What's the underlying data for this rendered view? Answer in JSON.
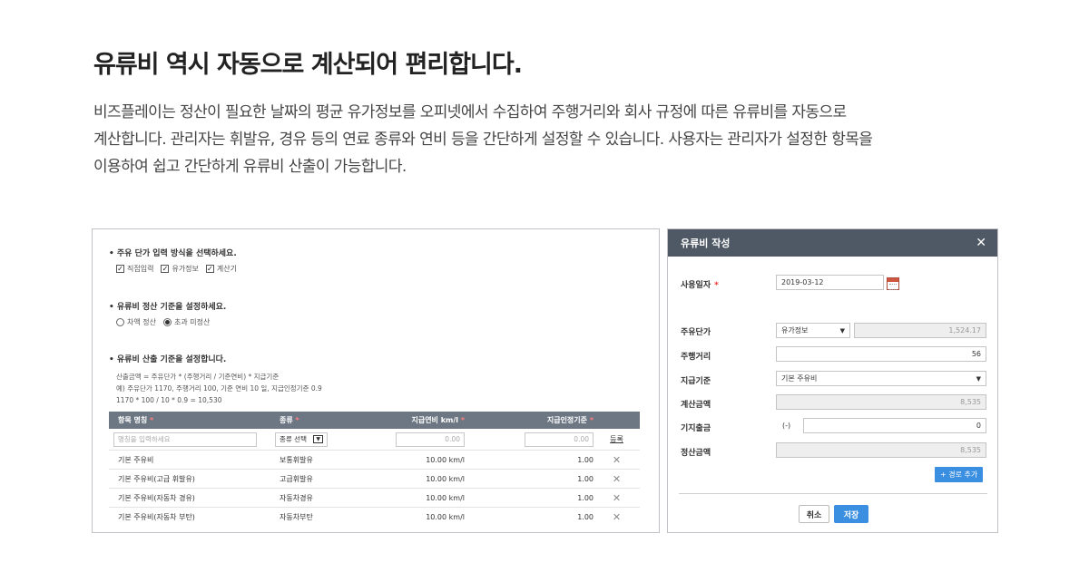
{
  "heading": "유류비 역시 자동으로 계산되어 편리합니다.",
  "description": [
    "비즈플레이는 정산이 필요한 날짜의 평균 유가정보를 오피넷에서 수집하여 주행거리와 회사 규정에 따른 유류비를 자동으로",
    "계산합니다. 관리자는 휘발유, 경유 등의 연료 종류와 연비 등을 간단하게 설정할 수 있습니다. 사용자는 관리자가 설정한 항목을",
    "이용하여 쉽고 간단하게 유류비 산출이 가능합니다."
  ],
  "settings": {
    "section1": {
      "title": "• 주유 단가 입력 방식을 선택하세요.",
      "options": [
        {
          "label": "직접입력",
          "checked": true
        },
        {
          "label": "유가정보",
          "checked": true
        },
        {
          "label": "계산기",
          "checked": true
        }
      ]
    },
    "section2": {
      "title": "• 유류비 정산 기준을 설정하세요.",
      "options": [
        {
          "label": "차액 정산",
          "selected": false
        },
        {
          "label": "초과 미정산",
          "selected": true
        }
      ]
    },
    "section3": {
      "title": "• 유류비 산출 기준을 설정합니다.",
      "formula": [
        "산출금액 = 주유단가 * (주행거리 / 기준연비) * 지급기준",
        "예) 주유단가 1170, 주행거리 100, 기준 연비 10 일, 지급인정기준 0.9",
        "      1170 * 100 / 10 * 0.9 = 10,530"
      ]
    },
    "table": {
      "headers": {
        "name": "항목 명칭",
        "type": "종류",
        "fuel": "지급연비 km/l",
        "rate": "지급인정기준",
        "req": "*"
      },
      "input": {
        "name_placeholder": "명칭을 입력하세요",
        "type_select": "종류 선택",
        "fuel_value": "0.00",
        "rate_value": "0.00",
        "register": "등록"
      },
      "rows": [
        {
          "name": "기본 주유비",
          "type": "보통휘발유",
          "fuel": "10.00 km/l",
          "rate": "1.00"
        },
        {
          "name": "기본 주유비(고급 휘발유)",
          "type": "고급휘발유",
          "fuel": "10.00 km/l",
          "rate": "1.00"
        },
        {
          "name": "기본 주유비(자동차 경유)",
          "type": "자동차경유",
          "fuel": "10.00 km/l",
          "rate": "1.00"
        },
        {
          "name": "기본 주유비(자동차 부탄)",
          "type": "자동차부탄",
          "fuel": "10.00 km/l",
          "rate": "1.00"
        }
      ]
    }
  },
  "dialog": {
    "title": "유류비 작성",
    "close": "✕",
    "fields": {
      "date": {
        "label": "사용일자",
        "value": "2019-03-12",
        "required": "*"
      },
      "unit_price": {
        "label": "주유단가",
        "select": "유가정보",
        "value": "1,524.17"
      },
      "distance": {
        "label": "주행거리",
        "value": "56"
      },
      "standard": {
        "label": "지급기준",
        "value": "기본 주유비"
      },
      "calc_amount": {
        "label": "계산금액",
        "value": "8,535"
      },
      "existing": {
        "label": "기지출금",
        "sign": "(-)",
        "value": "0"
      },
      "settle_amount": {
        "label": "정산금액",
        "value": "8,535"
      }
    },
    "add_route": "+ 경로 추가",
    "cancel": "취소",
    "save": "저장"
  }
}
